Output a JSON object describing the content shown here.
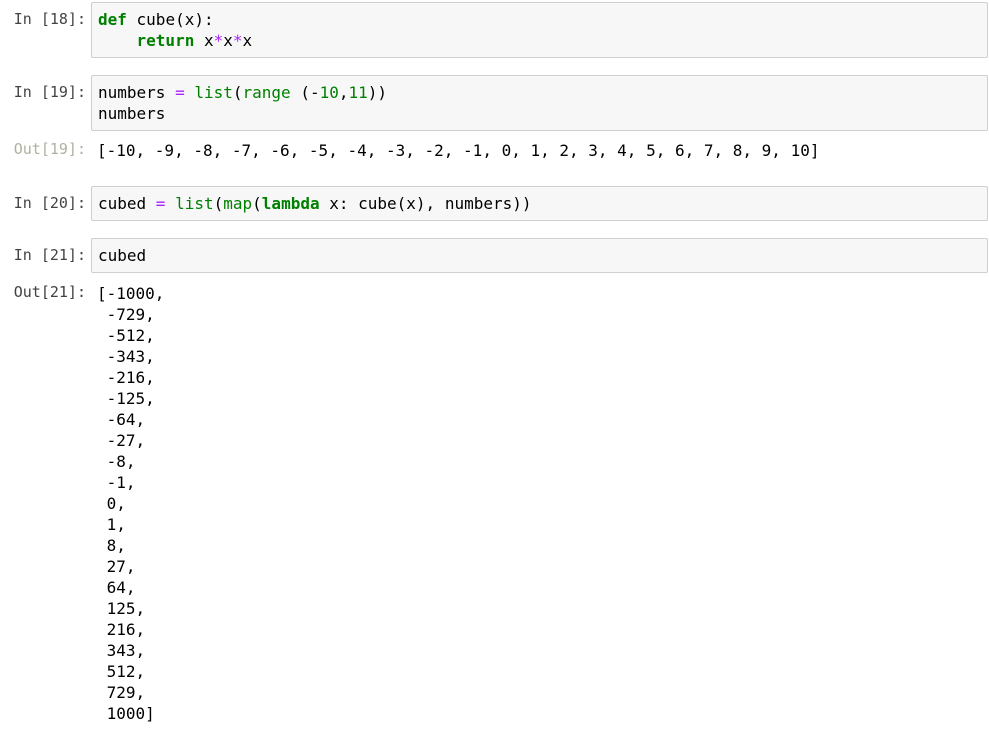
{
  "cells": {
    "c18": {
      "prompt": "In [18]:",
      "line1": {
        "kw": "def",
        "rest": " cube(x):"
      },
      "line2": {
        "indent": "    ",
        "kw": "return",
        "rest": " x*x*x"
      }
    },
    "c19": {
      "prompt": "In [19]:",
      "line1": "numbers = list(range (-10,11))",
      "line2": "numbers",
      "out_prompt": "Out[19]:",
      "output": "[-10, -9, -8, -7, -6, -5, -4, -3, -2, -1, 0, 1, 2, 3, 4, 5, 6, 7, 8, 9, 10]"
    },
    "c20": {
      "prompt": "In [20]:",
      "line1": "cubed = list(map(lambda x: cube(x), numbers))"
    },
    "c21": {
      "prompt": "In [21]:",
      "line1": "cubed",
      "out_prompt": "Out[21]:",
      "output_lines": [
        "[-1000,",
        " -729,",
        " -512,",
        " -343,",
        " -216,",
        " -125,",
        " -64,",
        " -27,",
        " -8,",
        " -1,",
        " 0,",
        " 1,",
        " 8,",
        " 27,",
        " 64,",
        " 125,",
        " 216,",
        " 343,",
        " 512,",
        " 729,",
        " 1000]"
      ]
    }
  },
  "colors": {
    "keyword": "#008000",
    "operator": "#aa22ff",
    "input_bg": "#f7f7f7",
    "input_border": "#cfcfcf"
  }
}
